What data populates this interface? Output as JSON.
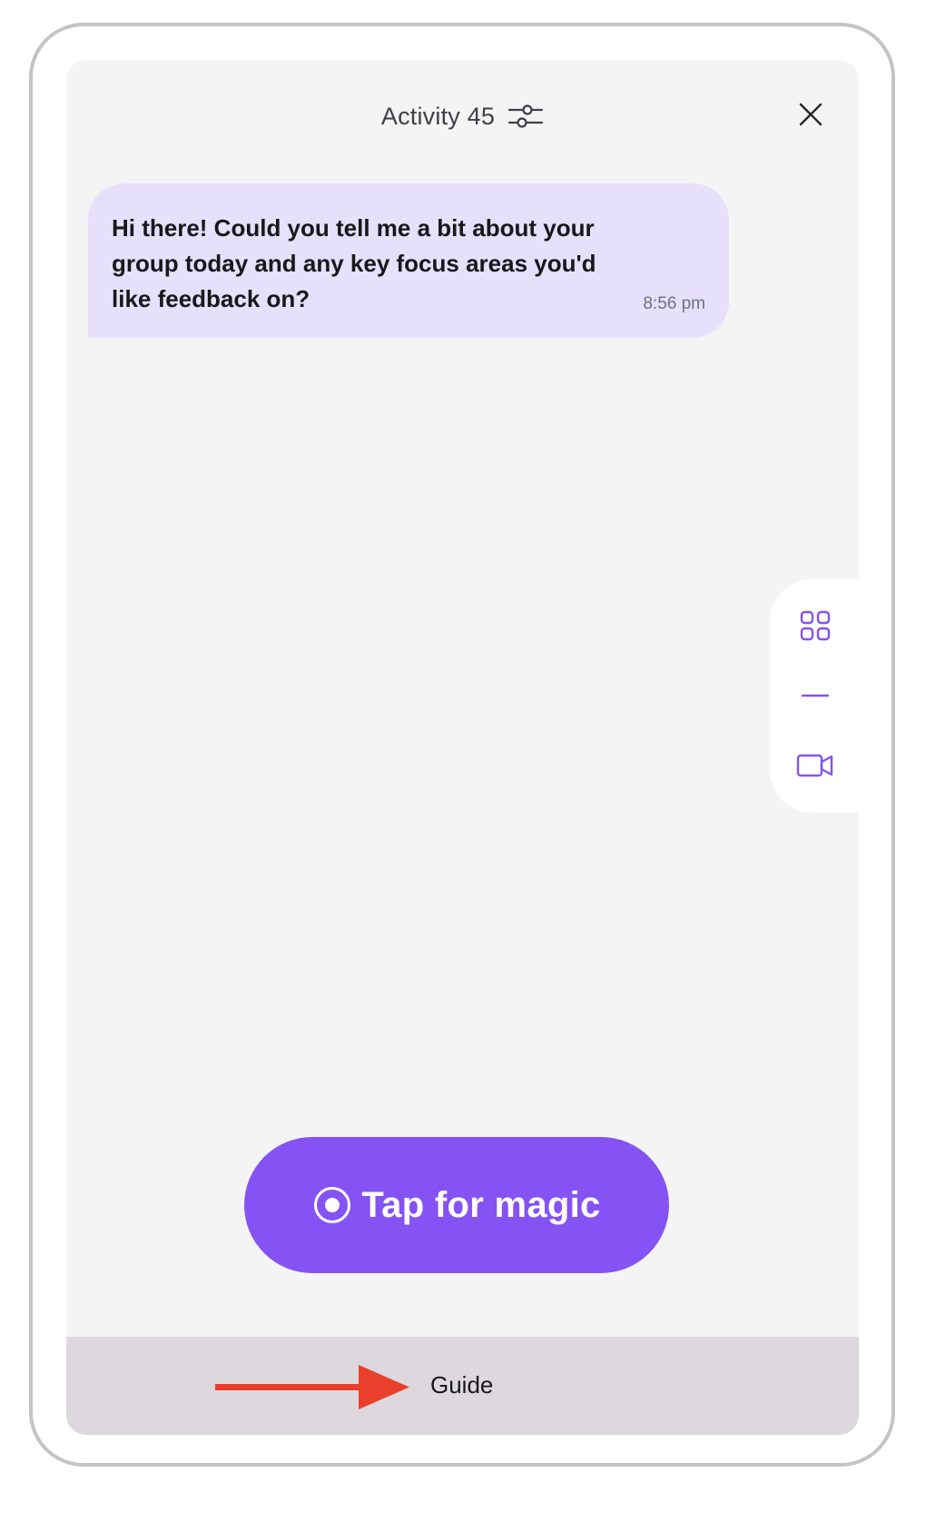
{
  "header": {
    "title": "Activity 45",
    "filter_icon": "sliders-icon",
    "close_icon": "close-icon"
  },
  "chat": {
    "messages": [
      {
        "text": "Hi there! Could you tell me a bit about your group today and any key focus areas you'd like feedback on?",
        "time": "8:56 pm"
      }
    ]
  },
  "side_panel": {
    "icons": [
      "grid-icon",
      "minus-icon",
      "video-camera-icon"
    ]
  },
  "action": {
    "label": "Tap for magic",
    "icon": "record-icon"
  },
  "guide": {
    "label": "Guide",
    "arrow_icon": "arrow-right-icon"
  },
  "colors": {
    "accent": "#8552f3",
    "bubble": "#e6e0fb",
    "screen_bg": "#f4f4f5",
    "guide_bar": "#dcd8dd",
    "arrow": "#e8402c"
  }
}
